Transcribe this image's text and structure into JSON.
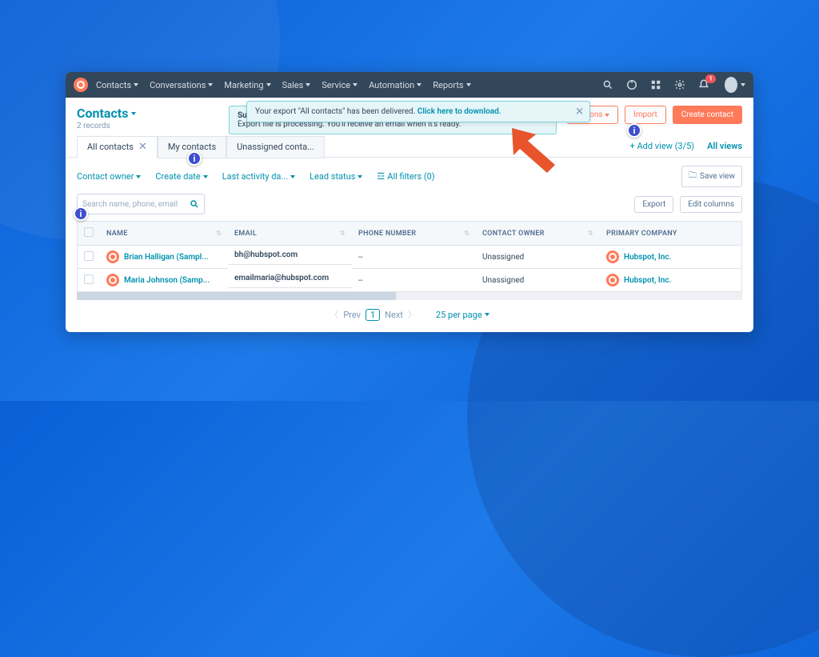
{
  "nav": {
    "items": [
      "Contacts",
      "Conversations",
      "Marketing",
      "Sales",
      "Service",
      "Automation",
      "Reports"
    ],
    "notification_count": "1"
  },
  "header": {
    "title": "Contacts",
    "subtitle": "2 records",
    "actions_btn": "Actions",
    "import_btn": "Import",
    "create_btn": "Create contact"
  },
  "bannerUnder": {
    "prefix": "Su",
    "text": "Export file is processing. You'll receive an email when it's ready."
  },
  "bannerOver": {
    "text": "Your export \"All contacts\" has been delivered.",
    "link": "Click here to download."
  },
  "tabs": {
    "t0": "All contacts",
    "t1": "My contacts",
    "t2": "Unassigned conta...",
    "add": "Add view (3/5)",
    "all": "All views"
  },
  "filters": {
    "owner": "Contact owner",
    "create": "Create date",
    "activity": "Last activity da...",
    "lead": "Lead status",
    "all": "All filters (0)",
    "save": "Save view"
  },
  "search": {
    "placeholder": "Search name, phone, email"
  },
  "tableActions": {
    "export": "Export",
    "editcols": "Edit columns"
  },
  "cols": {
    "name": "NAME",
    "email": "EMAIL",
    "phone": "PHONE NUMBER",
    "owner": "CONTACT OWNER",
    "company": "PRIMARY COMPANY"
  },
  "rows": [
    {
      "name": "Brian Halligan (Sampl...",
      "email": "bh@hubspot.com",
      "phone": "--",
      "owner": "Unassigned",
      "company": "Hubspot, Inc."
    },
    {
      "name": "Maria Johnson (Samp...",
      "email": "emailmaria@hubspot.com",
      "phone": "--",
      "owner": "Unassigned",
      "company": "Hubspot, Inc."
    }
  ],
  "pager": {
    "prev": "Prev",
    "cur": "1",
    "next": "Next",
    "perpage": "25 per page"
  }
}
